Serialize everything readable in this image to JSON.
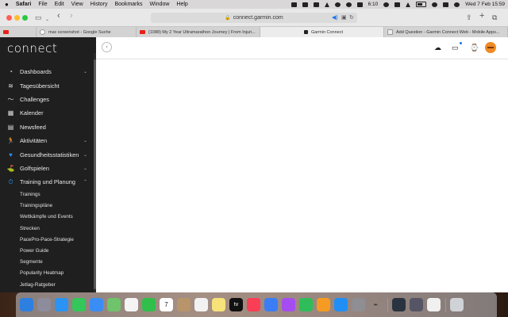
{
  "menubar": {
    "apple": "",
    "items": [
      "Safari",
      "File",
      "Edit",
      "View",
      "History",
      "Bookmarks",
      "Window",
      "Help"
    ],
    "time_small": "6:10",
    "datetime": "Wed 7 Feb  15:59"
  },
  "toolbar": {
    "url": "connect.garmin.com",
    "back": "‹",
    "forward": "›",
    "share_icon": "share-icon",
    "new_tab": "+",
    "tabs_icon": "tab-overview-icon"
  },
  "tabs": [
    {
      "label": "mac screenshot - Google Suche",
      "favicon": "google-favicon"
    },
    {
      "label": "(1088) My 2 Year Ultramarathon Journey | From Injuri...",
      "favicon": "youtube-favicon"
    },
    {
      "label": "Garmin Connect",
      "favicon": "garmin-favicon"
    },
    {
      "label": "Add Question - Garmin Connect Web - Mobile Apps...",
      "favicon": "garmin-favicon"
    }
  ],
  "sidebar": {
    "logo": "connect",
    "items": [
      {
        "label": "Dashboards",
        "icon": "dashboard-icon",
        "chevron": "⌄"
      },
      {
        "label": "Tagesübersicht",
        "icon": "layers-icon"
      },
      {
        "label": "Challenges",
        "icon": "challenges-icon"
      },
      {
        "label": "Kalender",
        "icon": "calendar-icon"
      },
      {
        "label": "Newsfeed",
        "icon": "newsfeed-icon"
      },
      {
        "label": "Aktivitäten",
        "icon": "running-icon",
        "chevron": "⌄"
      },
      {
        "label": "Gesundheitsstatistiken",
        "icon": "heart-icon",
        "chevron": "⌄"
      },
      {
        "label": "Golfspielen",
        "icon": "golf-icon",
        "chevron": "⌄"
      },
      {
        "label": "Training und Planung",
        "icon": "stopwatch-icon",
        "chevron": "⌃"
      }
    ],
    "subitems": [
      "Trainings",
      "Trainingspläne",
      "Wettkämpfe und Events",
      "Strecken",
      "PacePro-Pace-Strategie",
      "Power Guide",
      "Segmente",
      "Popularity Heatmap",
      "Jetlag-Ratgeber"
    ]
  },
  "header": {
    "back_icon": "back-icon",
    "icons": [
      "upload-icon",
      "notification-icon",
      "device-icon"
    ],
    "avatar": "avatar"
  },
  "dock": {
    "icons": [
      "finder-icon",
      "launchpad-icon",
      "safari-icon",
      "messages-icon",
      "mail-icon",
      "maps-icon",
      "photos-icon",
      "facetime-icon",
      "calendar-icon",
      "contacts-icon",
      "reminders-icon",
      "notes-icon",
      "tv-icon",
      "music-icon",
      "keynote-icon",
      "podcasts-icon",
      "numbers-icon",
      "pages-icon",
      "app-store-icon",
      "system-preferences-icon",
      "pen-icon",
      "screenshot-icon",
      "preview-icon",
      "trash-icon"
    ],
    "calendar_day": "7",
    "tv_label": "tv"
  }
}
